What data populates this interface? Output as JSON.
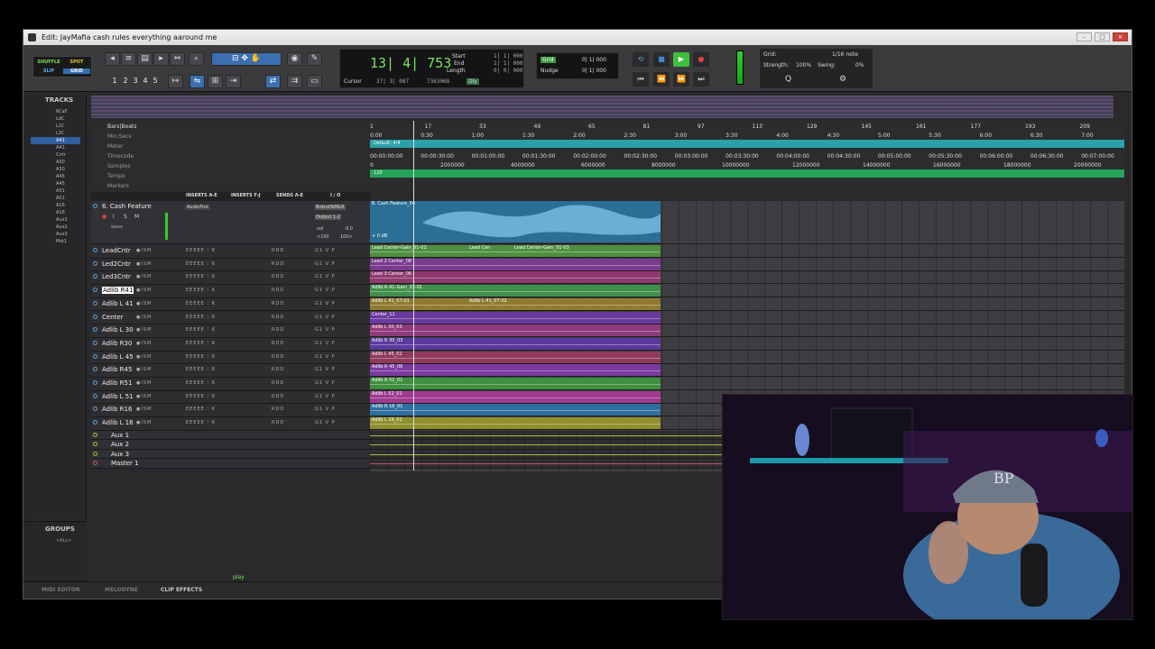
{
  "window": {
    "title": "Edit: JayMafia cash rules everything aaround me"
  },
  "toolbar": {
    "modes": [
      "SHUFFLE",
      "SPOT",
      "SLIP",
      "GRID"
    ],
    "zoom_presets": [
      "1",
      "2",
      "3",
      "4",
      "5"
    ],
    "counter": {
      "main": "13| 4| 753",
      "cursor_label": "Cursor",
      "cursor_value": "37| 3| 087",
      "start_label": "Start",
      "end_label": "End",
      "length_label": "Length",
      "start_value": "1| 1| 000",
      "end_value": "1| 1| 000",
      "length_value": "0| 0| 000",
      "samples_value": "7363068",
      "dly": "Dly"
    },
    "grid_nudge": {
      "grid_label": "Grid",
      "grid_value": "0| 1| 000",
      "nudge_label": "Nudge",
      "nudge_value": "0| 1| 000"
    },
    "quantize": {
      "grid_label": "Grid:",
      "grid_value": "1/16 note",
      "strength_label": "Strength:",
      "strength_value": "100%",
      "swing_label": "Swing:",
      "swing_value": "0%"
    }
  },
  "tracks_panel": {
    "title": "TRACKS",
    "items": [
      "6CaF",
      "LdC",
      "L2C",
      "L3C",
      "A41",
      "A41",
      "Cntr",
      "A30",
      "A30",
      "A45",
      "A45",
      "A51",
      "A51",
      "A16",
      "A16",
      "Aux1",
      "Aux2",
      "Aux3",
      "Mst1"
    ],
    "selected_index": 4
  },
  "groups_panel": {
    "title": "GROUPS",
    "all": "<ALL>"
  },
  "rulers": {
    "labels": [
      "Bars|Beats",
      "Min:Secs",
      "Meter",
      "Timecode",
      "Samples",
      "Tempo",
      "Markers"
    ],
    "bars": [
      "1",
      "17",
      "33",
      "49",
      "65",
      "81",
      "97",
      "113",
      "129",
      "145",
      "161",
      "177",
      "193",
      "209"
    ],
    "minsecs": [
      "0:00",
      "0:30",
      "1:00",
      "1:30",
      "2:00",
      "2:30",
      "3:00",
      "3:30",
      "4:00",
      "4:30",
      "5:00",
      "5:30",
      "6:00",
      "6:30",
      "7:00"
    ],
    "timecode": [
      "00:00:00:00",
      "00:00:30:00",
      "00:01:00:00",
      "00:01:30:00",
      "00:02:00:00",
      "00:02:30:00",
      "00:03:00:00",
      "00:03:30:00",
      "00:04:00:00",
      "00:04:30:00",
      "00:05:00:00",
      "00:05:30:00",
      "00:06:00:00",
      "00:06:30:00",
      "00:07:00:00"
    ],
    "samples": [
      "0",
      "2000000",
      "4000000",
      "6000000",
      "8000000",
      "10000000",
      "12000000",
      "14000000",
      "16000000",
      "18000000",
      "20000000"
    ],
    "meter_value": "Default: 4/4",
    "tempo_value": "120"
  },
  "column_headers": [
    "INSERTS A-E",
    "INSERTS F-J",
    "SENDS A-E",
    "I / O"
  ],
  "feature_track": {
    "name": "6. Cash Feature",
    "insert": "AudioTrck",
    "io_input": "BrdcstStMLR",
    "io_output": "Output 1-2",
    "vol_label": "vol",
    "vol_value": "0.0",
    "pan_l": "<100",
    "pan_r": "100>",
    "clip": "6. Cash Feature_04",
    "clip_db": "+ 0 dB",
    "wave": "wave"
  },
  "tracks": [
    {
      "name": "LeadCntr",
      "clip": "Lead Center-Gain_51-02",
      "clip2": "Lead Cen",
      "clip3": "Lead Center-Gain_51-03",
      "color": "#4f8f3f"
    },
    {
      "name": "Led2Cntr",
      "clip": "Lead 2 Center_08",
      "color": "#7a3a8f"
    },
    {
      "name": "Led3Cntr",
      "clip": "Lead 3 Center_06",
      "color": "#8f3a6e"
    },
    {
      "name": "Adlib R41",
      "clip": "Adlib R 41-Gain_23-01",
      "color": "#3f8f4a",
      "selected": true
    },
    {
      "name": "Adlib L 41",
      "clip": "Adlib L 41_07-01",
      "clip2": "Adlib L 41_07-02",
      "color": "#8f7a2f"
    },
    {
      "name": "Center",
      "clip": "Center_11",
      "color": "#6a3a9f"
    },
    {
      "name": "Adlib L 30",
      "clip": "Adlib L 30_03",
      "color": "#8f3a7a"
    },
    {
      "name": "Adlib R30",
      "clip": "Adlib R 30_03",
      "color": "#5a3a9f"
    },
    {
      "name": "Adlib L 45",
      "clip": "Adlib L 45_01",
      "color": "#8f3a5a"
    },
    {
      "name": "Adlib R45",
      "clip": "Adlib R 45_06",
      "color": "#7a3a9f"
    },
    {
      "name": "Adlib R51",
      "clip": "Adlib R 51_01",
      "color": "#3f8f3f"
    },
    {
      "name": "Adlib L 51",
      "clip": "Adlib L 51_01",
      "color": "#9f3a8f"
    },
    {
      "name": "Adlib R16",
      "clip": "Adlib R 16_01",
      "color": "#2f6f9f"
    },
    {
      "name": "Adlib L 16",
      "clip": "Adlib L 16_01",
      "color": "#8f8f2f"
    }
  ],
  "aux_tracks": [
    {
      "name": "Aux 1",
      "color": "#9fbf3a"
    },
    {
      "name": "Aux 2",
      "color": "#9fbf3a"
    },
    {
      "name": "Aux 3",
      "color": "#9fbf3a"
    },
    {
      "name": "Master 1",
      "color": "#c0506a"
    }
  ],
  "transport_status": "play",
  "bottom_tabs": [
    "MIDI EDITOR",
    "MELODYNE",
    "CLIP EFFECTS"
  ],
  "active_tab": "CLIP EFFECTS"
}
